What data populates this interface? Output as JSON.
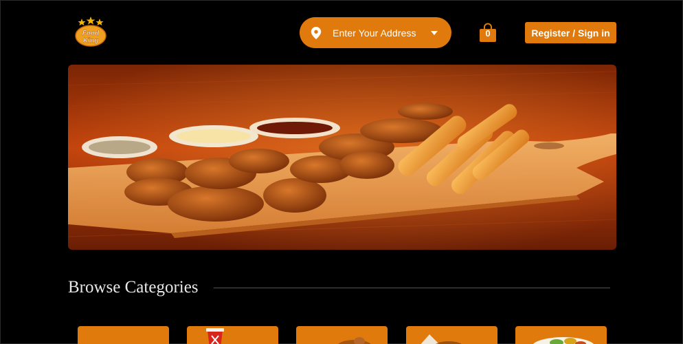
{
  "header": {
    "logo_text": "Food King",
    "address_placeholder": "Enter Your Address",
    "cart_count": "0",
    "auth_label": "Register / Sign in"
  },
  "hero": {
    "image": "fried chicken nuggets and mozzarella sticks on a wooden board with dipping sauces"
  },
  "categories": {
    "title": "Browse Categories",
    "items": [
      {
        "icon": "category-image-1"
      },
      {
        "icon": "drink-cup-icon"
      },
      {
        "icon": "category-image-3"
      },
      {
        "icon": "category-image-4"
      },
      {
        "icon": "category-image-5"
      }
    ]
  },
  "colors": {
    "accent": "#e07a0c",
    "background": "#000000",
    "heading": "#e8e8e8"
  }
}
